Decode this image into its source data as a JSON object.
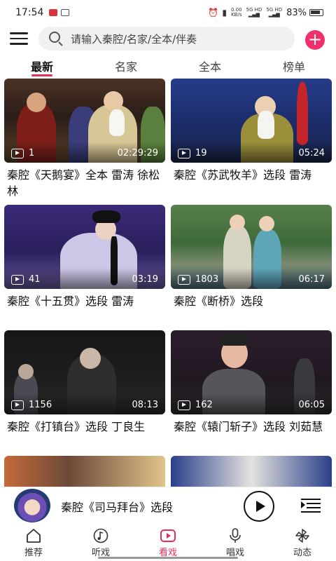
{
  "status_bar": {
    "time": "17:54",
    "net_speed_value": "0.00",
    "net_speed_unit": "KB/s",
    "signal1": "5G HD",
    "signal2": "5G HD",
    "battery": "83%"
  },
  "search": {
    "placeholder": "请输入秦腔/名家/全本/伴奏"
  },
  "add_button": "+",
  "tabs": [
    {
      "label": "最新",
      "active": true
    },
    {
      "label": "名家",
      "active": false
    },
    {
      "label": "全本",
      "active": false
    },
    {
      "label": "榜单",
      "active": false
    }
  ],
  "videos": [
    {
      "title": "秦腔《天鹅宴》全本 雷涛 徐松林",
      "plays": "1",
      "duration": "02:29:29"
    },
    {
      "title": "秦腔《苏武牧羊》选段 雷涛",
      "plays": "19",
      "duration": "05:24"
    },
    {
      "title": "秦腔《十五贯》选段 雷涛",
      "plays": "41",
      "duration": "03:19"
    },
    {
      "title": "秦腔《断桥》选段",
      "plays": "1803",
      "duration": "06:17"
    },
    {
      "title": "秦腔《打镇台》选段 丁良生",
      "plays": "1156",
      "duration": "08:13"
    },
    {
      "title": "秦腔《辕门斩子》选段 刘茹慧",
      "plays": "162",
      "duration": "06:05"
    }
  ],
  "player": {
    "title": "秦腔《司马拜台》选段"
  },
  "bottom_nav": [
    {
      "label": "推荐",
      "icon": "home-icon",
      "active": false
    },
    {
      "label": "听戏",
      "icon": "music-note-icon",
      "active": false
    },
    {
      "label": "看戏",
      "icon": "video-play-icon",
      "active": true
    },
    {
      "label": "唱戏",
      "icon": "microphone-icon",
      "active": false
    },
    {
      "label": "动态",
      "icon": "pinwheel-icon",
      "active": false
    }
  ],
  "colors": {
    "accent": "#e62e55",
    "add_button": "#f0306a"
  }
}
